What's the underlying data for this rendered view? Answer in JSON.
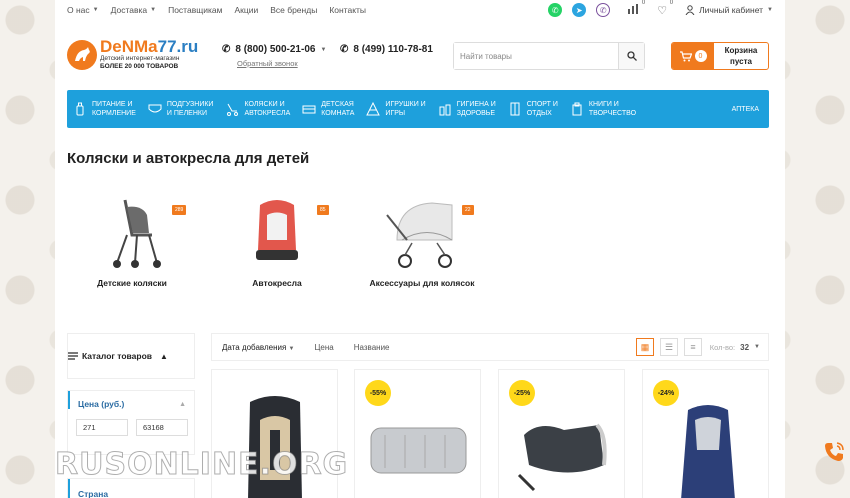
{
  "topnav": [
    {
      "label": "О нас",
      "caret": true
    },
    {
      "label": "Доставка",
      "caret": true
    },
    {
      "label": "Поставщикам",
      "caret": false
    },
    {
      "label": "Акции",
      "caret": false
    },
    {
      "label": "Все бренды",
      "caret": false
    },
    {
      "label": "Контакты",
      "caret": false
    }
  ],
  "topbar": {
    "compare_count": "0",
    "favorites_count": "0",
    "cabinet_label": "Личный кабинет"
  },
  "logo": {
    "name_main": "DeNMa",
    "name_suffix": "77.ru",
    "subtitle": "Детский интернет-магазин",
    "tagline": "БОЛЕЕ 20 000 ТОВАРОВ"
  },
  "contacts": {
    "phone1": "8 (800) 500-21-06",
    "callback": "Обратный звонок",
    "phone2": "8 (499) 110-78-81"
  },
  "search": {
    "placeholder": "Найти товары"
  },
  "cart": {
    "count": "0",
    "line1": "Корзина",
    "line2": "пуста"
  },
  "menu": [
    {
      "l1": "Питание и",
      "l2": "кормление",
      "icon": "bottle-icon"
    },
    {
      "l1": "Подгузники",
      "l2": "и пеленки",
      "icon": "diaper-icon"
    },
    {
      "l1": "Коляски и",
      "l2": "автокресла",
      "icon": "stroller-icon"
    },
    {
      "l1": "Детская",
      "l2": "комната",
      "icon": "bed-icon"
    },
    {
      "l1": "Игрушки и",
      "l2": "игры",
      "icon": "pyramid-icon"
    },
    {
      "l1": "Гигиена и",
      "l2": "здоровье",
      "icon": "hygiene-icon"
    },
    {
      "l1": "Спорт и",
      "l2": "отдых",
      "icon": "sport-icon"
    },
    {
      "l1": "Книги и",
      "l2": "творчество",
      "icon": "book-icon"
    },
    {
      "l1": "Аптека",
      "l2": "",
      "icon": ""
    }
  ],
  "page": {
    "title": "Коляски и автокресла для детей"
  },
  "categories": [
    {
      "name": "Детские коляски",
      "count": "289"
    },
    {
      "name": "Автокресла",
      "count": "85"
    },
    {
      "name": "Аксессуары для колясок",
      "count": "22"
    }
  ],
  "sidebar": {
    "catalog_label": "Каталог товаров",
    "price_title": "Цена (руб.)",
    "price_from": "271",
    "price_to": "63168",
    "country_title": "Страна"
  },
  "sort": {
    "items": [
      "Дата добавления",
      "Цена",
      "Название"
    ],
    "perpage_label": "Кол-во:",
    "perpage_value": "32"
  },
  "products": [
    {
      "discount": ""
    },
    {
      "discount": "-55%"
    },
    {
      "discount": "-25%"
    },
    {
      "discount": "-24%"
    }
  ],
  "colors": {
    "accent": "#f07a1e",
    "menu": "#1ea0dc",
    "discount": "#ffd81a"
  },
  "watermark": "RUSONLINE.ORG"
}
